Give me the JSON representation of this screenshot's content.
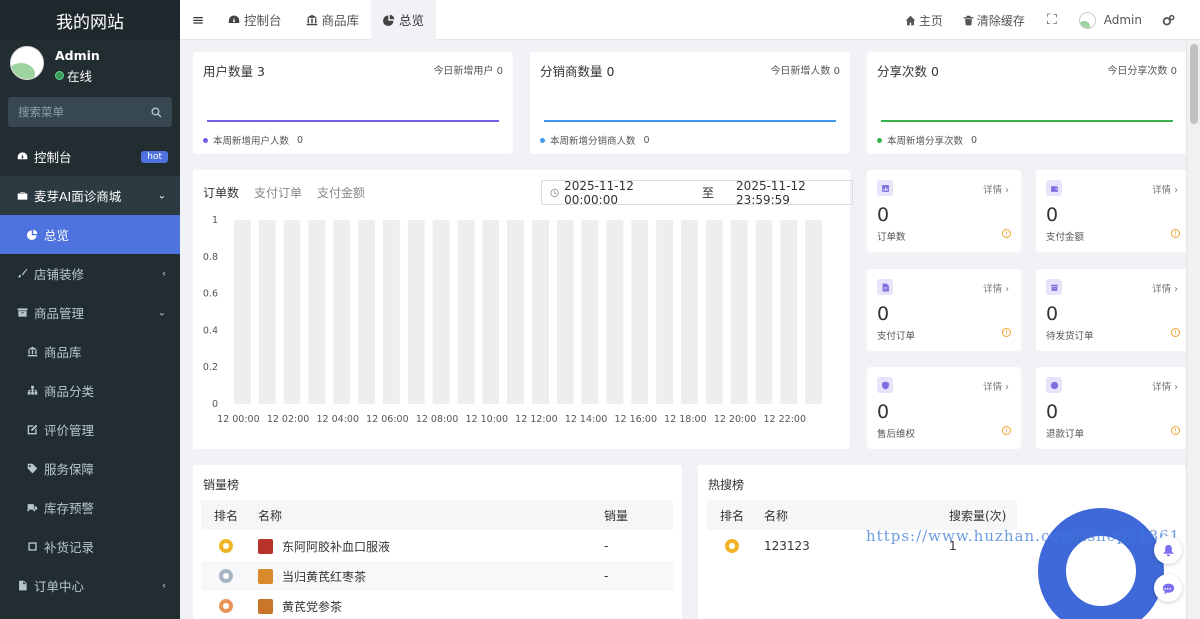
{
  "sidebar": {
    "logo": "我的网站",
    "user": {
      "name": "Admin",
      "status": "在线"
    },
    "search_placeholder": "搜索菜单",
    "items": [
      {
        "label": "控制台",
        "badge": "hot",
        "icon": "dashboard-icon"
      },
      {
        "label": "麦芽AI面诊商城",
        "icon": "briefcase-icon"
      },
      {
        "label": "总览",
        "icon": "pie-chart-icon"
      },
      {
        "label": "店铺装修",
        "icon": "brush-icon"
      },
      {
        "label": "商品管理",
        "icon": "archive-icon"
      },
      {
        "label": "商品库",
        "icon": "bank-icon"
      },
      {
        "label": "商品分类",
        "icon": "sitemap-icon"
      },
      {
        "label": "评价管理",
        "icon": "edit-icon"
      },
      {
        "label": "服务保障",
        "icon": "tag-icon"
      },
      {
        "label": "库存预警",
        "icon": "truck-icon"
      },
      {
        "label": "补货记录",
        "icon": "note-icon"
      },
      {
        "label": "订单中心",
        "icon": "file-icon"
      }
    ]
  },
  "topbar": {
    "tabs": [
      {
        "label": "控制台",
        "icon": "dashboard-icon"
      },
      {
        "label": "商品库",
        "icon": "bank-icon"
      },
      {
        "label": "总览",
        "icon": "pie-chart-icon"
      }
    ],
    "home": "主页",
    "clear_cache": "清除缓存",
    "user": "Admin"
  },
  "stats": [
    {
      "title": "用户数量",
      "value": "3",
      "today_label": "今日新增用户",
      "today_value": "0",
      "week_label": "本周新增用户人数",
      "week_value": "0",
      "color": "#7b5ee8"
    },
    {
      "title": "分销商数量",
      "value": "0",
      "today_label": "今日新增人数",
      "today_value": "0",
      "week_label": "本周新增分销商人数",
      "week_value": "0",
      "color": "#3e9ae8"
    },
    {
      "title": "分享次数",
      "value": "0",
      "today_label": "今日分享次数",
      "today_value": "0",
      "week_label": "本周新增分享次数",
      "week_value": "0",
      "color": "#37b24d"
    }
  ],
  "order_chart": {
    "tabs": [
      "订单数",
      "支付订单",
      "支付金额"
    ],
    "date_start": "2025-11-12 00:00:00",
    "date_sep": "至",
    "date_end": "2025-11-12 23:59:59"
  },
  "chart_data": {
    "type": "bar",
    "categories": [
      "12 00:00",
      "12 01:00",
      "12 02:00",
      "12 03:00",
      "12 04:00",
      "12 05:00",
      "12 06:00",
      "12 07:00",
      "12 08:00",
      "12 09:00",
      "12 10:00",
      "12 11:00",
      "12 12:00",
      "12 13:00",
      "12 14:00",
      "12 15:00",
      "12 16:00",
      "12 17:00",
      "12 18:00",
      "12 19:00",
      "12 20:00",
      "12 21:00",
      "12 22:00",
      "12 23:00"
    ],
    "values": [
      0,
      0,
      0,
      0,
      0,
      0,
      0,
      0,
      0,
      0,
      0,
      0,
      0,
      0,
      0,
      0,
      0,
      0,
      0,
      0,
      0,
      0,
      0,
      0
    ],
    "ylim": [
      0,
      1
    ],
    "yticks": [
      "0",
      "0.2",
      "0.4",
      "0.6",
      "0.8",
      "1"
    ],
    "xticks_shown": [
      "12 00:00",
      "12 02:00",
      "12 04:00",
      "12 06:00",
      "12 08:00",
      "12 10:00",
      "12 12:00",
      "12 14:00",
      "12 16:00",
      "12 18:00",
      "12 20:00",
      "12 22:00"
    ],
    "background_bar_color": "#eeeeee"
  },
  "mini_cards": [
    {
      "value": "0",
      "label": "订单数",
      "detail": "详情"
    },
    {
      "value": "0",
      "label": "支付金额",
      "detail": "详情"
    },
    {
      "value": "0",
      "label": "支付订单",
      "detail": "详情"
    },
    {
      "value": "0",
      "label": "待发货订单",
      "detail": "详情"
    },
    {
      "value": "0",
      "label": "售后维权",
      "detail": "详情"
    },
    {
      "value": "0",
      "label": "退款订单",
      "detail": "详情"
    }
  ],
  "sales_rank": {
    "title": "销量榜",
    "headers": [
      "排名",
      "名称",
      "销量"
    ],
    "rows": [
      {
        "name": "东阿阿胶补血口服液",
        "sales": "-",
        "medal": "#f0b429",
        "img": "#b8322a"
      },
      {
        "name": "当归黄芪红枣茶",
        "sales": "-",
        "medal": "#a8b4c4",
        "img": "#d98a2b"
      },
      {
        "name": "黄芪党参茶",
        "sales": "",
        "medal": "#e8955a",
        "img": "#c9762a"
      }
    ]
  },
  "hot_search": {
    "title": "热搜榜",
    "headers": [
      "排名",
      "名称",
      "搜索量(次)"
    ],
    "rows": [
      {
        "name": "123123",
        "count": "1",
        "medal": "#f0b429"
      }
    ]
  },
  "watermark": "https://www.huzhan.com/ishop51861"
}
